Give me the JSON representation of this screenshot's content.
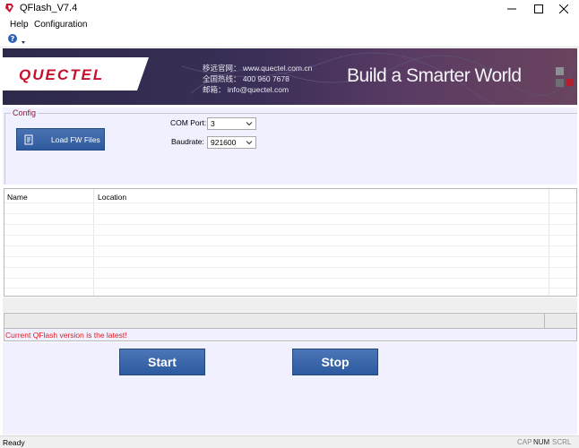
{
  "window": {
    "title": "QFlash_V7.4"
  },
  "menu": {
    "help": "Help",
    "configuration": "Configuration"
  },
  "banner": {
    "logo": "QUECTEL",
    "lines": [
      "移远官网：  www.quectel.com.cn",
      "全国热线：  400 960 7678",
      "邮箱：  info@quectel.com"
    ],
    "slogan": "Build a Smarter World"
  },
  "config": {
    "legend": "Config",
    "load_button": "Load FW Files",
    "com_port_label": "COM Port:",
    "com_port_value": "3",
    "baudrate_label": "Baudrate:",
    "baudrate_value": "921600"
  },
  "table": {
    "columns": [
      "Name",
      "Location"
    ]
  },
  "message": "Current QFlash version is the latest!",
  "buttons": {
    "start": "Start",
    "stop": "Stop"
  },
  "status": {
    "text": "Ready",
    "cap": "CAP",
    "num": "NUM",
    "scrl": "SCRL"
  },
  "colors": {
    "accent_button": "#2e5a9e",
    "message": "#e41a1a",
    "panel": "#f0f0ff"
  }
}
